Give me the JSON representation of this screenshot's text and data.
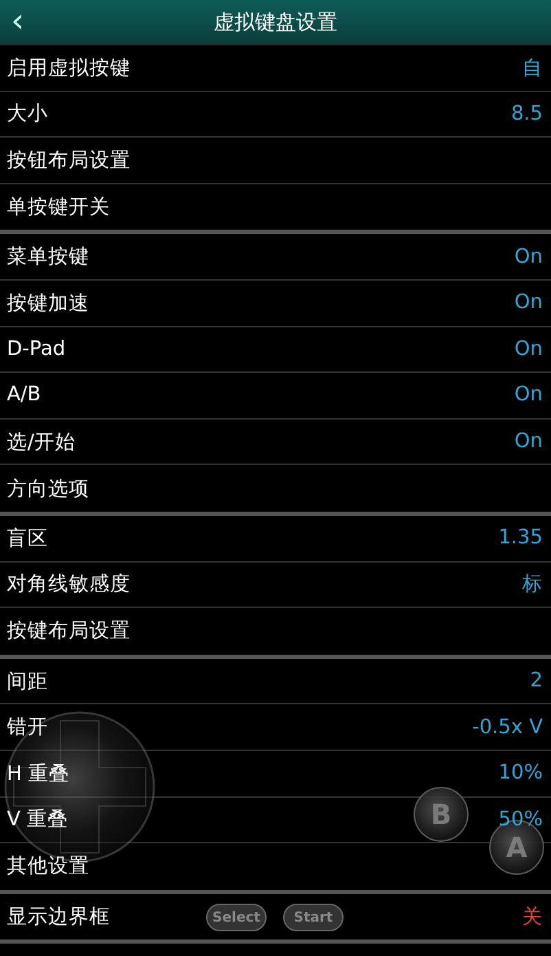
{
  "header": {
    "back": "‹",
    "title": "虚拟键盘设置"
  },
  "sections": [
    {
      "rows": [
        {
          "label": "启用虚拟按键",
          "value": "自",
          "color": "#2fa6d6"
        },
        {
          "label": "大小",
          "value": "8.5",
          "color": "#2fa6d6"
        },
        {
          "label": "按钮布局设置"
        },
        {
          "label": "单按键开关"
        }
      ]
    },
    {
      "rows": [
        {
          "label": "菜单按键",
          "value": "On",
          "color": "#2fa6d6"
        },
        {
          "label": "按键加速",
          "value": "On",
          "color": "#2fa6d6"
        },
        {
          "label": "D-Pad",
          "value": "On",
          "color": "#2fa6d6"
        },
        {
          "label": "A/B",
          "value": "On",
          "color": "#2fa6d6"
        },
        {
          "label": "选/开始",
          "value": "On",
          "color": "#2fa6d6"
        },
        {
          "label": "方向选项"
        }
      ]
    },
    {
      "rows": [
        {
          "label": "盲区",
          "value": "1.35",
          "color": "#2fa6d6"
        },
        {
          "label": "对角线敏感度",
          "value": "标",
          "color": "#2fa6d6"
        },
        {
          "label": "按键布局设置"
        }
      ]
    },
    {
      "rows": [
        {
          "label": "间距",
          "value": "2",
          "color": "#2fa6d6"
        },
        {
          "label": "错开",
          "value": "-0.5x V",
          "color": "#2fa6d6"
        },
        {
          "label": "H 重叠",
          "value": "10%",
          "color": "#2fa6d6"
        },
        {
          "label": "V 重叠",
          "value": "50%",
          "color": "#2fa6d6"
        },
        {
          "label": "其他设置"
        }
      ]
    },
    {
      "rows": [
        {
          "label": "显示边界框",
          "value": "关",
          "color": "#e0443a"
        }
      ]
    }
  ],
  "overlay": {
    "round_buttons": [
      "B",
      "A"
    ],
    "pill_buttons": [
      "Select",
      "Start"
    ]
  }
}
